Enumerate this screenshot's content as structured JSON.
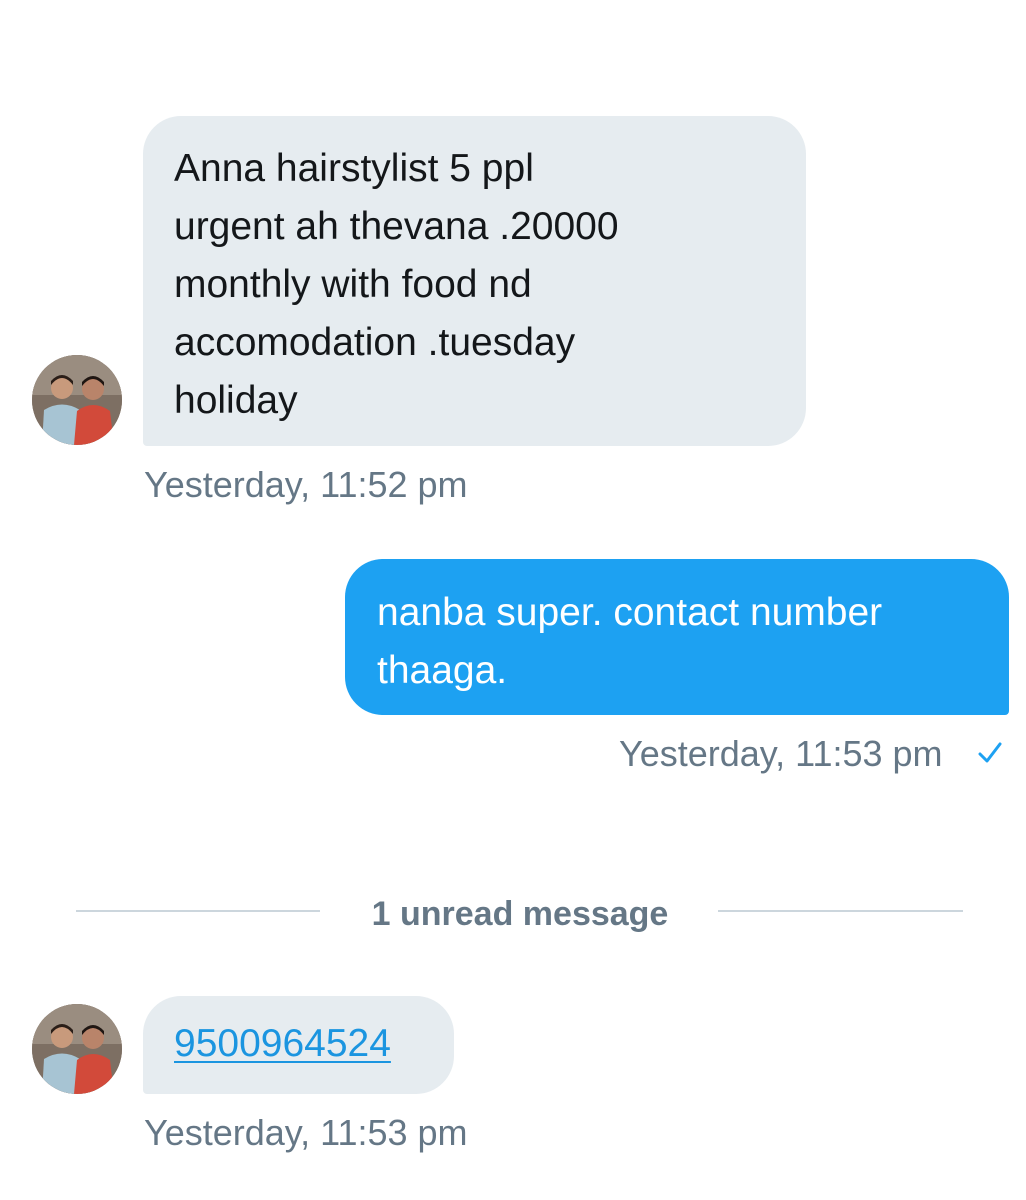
{
  "conversation": {
    "messages": [
      {
        "direction": "incoming",
        "lines": [
          "Anna hairstylist  5 ppl",
          "urgent ah thevana .20000",
          "monthly with food nd",
          "accomodation .tuesday",
          "holiday"
        ],
        "timestamp": "Yesterday, 11:52 pm"
      },
      {
        "direction": "outgoing",
        "lines": [
          "nanba super. contact number",
          "thaaga."
        ],
        "timestamp": "Yesterday, 11:53 pm",
        "status_icon": "check-icon"
      },
      {
        "direction": "incoming",
        "link_text": "9500964524",
        "timestamp": "Yesterday, 11:53 pm"
      }
    ],
    "unread_divider": {
      "label": "1 unread message"
    }
  },
  "colors": {
    "incoming_bubble": "#e6ecf0",
    "outgoing_bubble": "#1da1f2",
    "timestamp_text": "#657786",
    "link": "#1b95e0",
    "divider": "#ccd6dd"
  }
}
